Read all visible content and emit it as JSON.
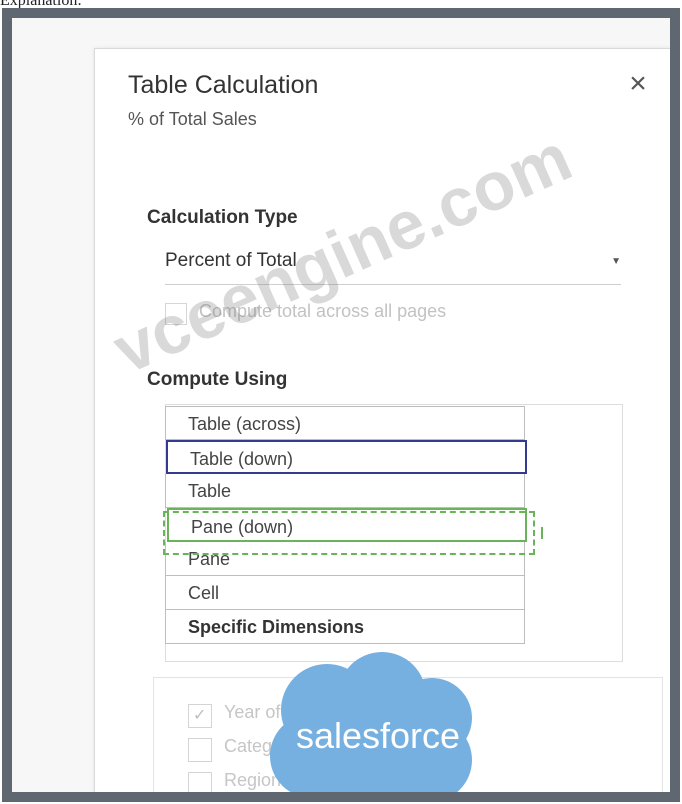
{
  "page": {
    "caption": "Explanation:"
  },
  "dialog": {
    "title": "Table Calculation",
    "subtitle": "% of Total Sales",
    "close_icon": "close-icon"
  },
  "calculation_type": {
    "label": "Calculation Type",
    "selected": "Percent of Total",
    "checkbox_label": "Compute total across all pages"
  },
  "compute_using": {
    "label": "Compute Using",
    "items": [
      {
        "label": "Table (across)"
      },
      {
        "label": "Table (down)"
      },
      {
        "label": "Table"
      },
      {
        "label": "Pane (down)"
      },
      {
        "label": "Pane"
      },
      {
        "label": "Cell"
      },
      {
        "label": "Specific Dimensions"
      }
    ]
  },
  "dimensions": {
    "items": [
      {
        "label": "Year of Date",
        "checked": true
      },
      {
        "label": "Category",
        "checked": false
      },
      {
        "label": "Region",
        "checked": false
      }
    ]
  },
  "watermark": {
    "text": "vceengine.com"
  },
  "logo": {
    "text": "salesforce",
    "color": "#76b0e0"
  }
}
